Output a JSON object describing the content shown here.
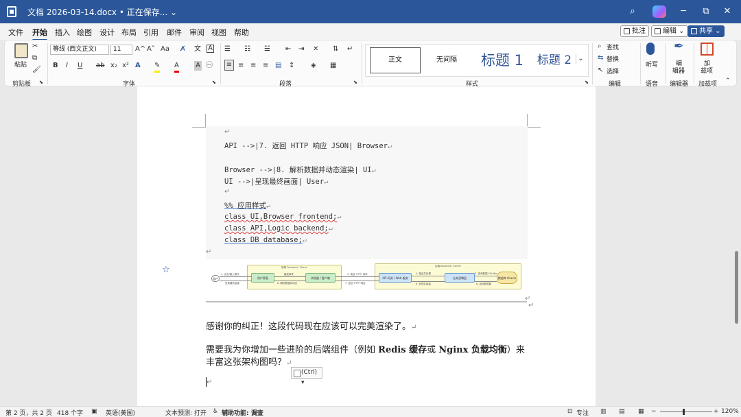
{
  "titlebar": {
    "title": "文档 2026-03-14.docx • 正在保存... ⌄",
    "search_icon": "search-icon",
    "minimize": "─",
    "restore": "⧉",
    "close": "✕"
  },
  "menu": {
    "tabs": [
      "文件",
      "开始",
      "插入",
      "绘图",
      "设计",
      "布局",
      "引用",
      "邮件",
      "审阅",
      "视图",
      "帮助"
    ],
    "active_index": 1,
    "comment_label": "批注",
    "edit_label": "编辑 ⌄",
    "share_label": "共享 ⌄"
  },
  "ribbon": {
    "clipboard": {
      "paste": "粘贴",
      "label": "剪贴板"
    },
    "font": {
      "font_name": "等线 (西文正文)",
      "font_size": "11",
      "grow": "A^",
      "shrink": "A˅",
      "change_case": "Aa",
      "bold": "B",
      "italic": "I",
      "underline": "U",
      "strike": "ab",
      "subscript": "x₂",
      "superscript": "x²",
      "label": "字体"
    },
    "paragraph": {
      "label": "段落"
    },
    "styles": {
      "items": [
        "正文",
        "无间隔",
        "标题 1",
        "标题 2"
      ],
      "label": "样式"
    },
    "editing": {
      "find": "查找",
      "replace": "替换",
      "select": "选择",
      "label": "编辑"
    },
    "voice": {
      "dictate": "听写",
      "label": "语音"
    },
    "editor": {
      "name": "编\n辑\n器",
      "name_line1": "编",
      "name_line2": "辑器",
      "label": "编辑器"
    },
    "addins": {
      "name_line1": "加",
      "name_line2": "载项",
      "label": "加载项"
    }
  },
  "document": {
    "code_lines": [
      {
        "pre": "API -->|7. 返回 HTTP 响应 JSON| Browser",
        "mark": true
      },
      {
        "pre": "Browser -->|8. 解析数据并动态渲染| UI",
        "mark": true
      },
      {
        "pre": "UI -->|呈现最终画面| User",
        "mark": true
      },
      {
        "pre": "%% 应用样式",
        "mark": true
      },
      {
        "pre": "class UI,Browser frontend;",
        "mark": true
      },
      {
        "pre": "class API,Logic backend;",
        "mark": true
      },
      {
        "pre": "class DB database;",
        "mark": true
      }
    ],
    "diagram": {
      "frontend_title": "前端 Frontend / Client",
      "backend_title": "后端 Backend / Server",
      "user": "用户",
      "ui": "用户界面",
      "browser": "浏览器 / 客户端",
      "api": "API 网关 / Web 服务",
      "logic": "业务逻辑层",
      "db": "数据库 Oracle",
      "e1": "1. 点击/输入操作",
      "e2": "触发事件",
      "e3": "3. 发起 HTTP 请求",
      "e4": "4. 路由并处理",
      "e5": "5. 查询数据 SQL/No",
      "e6": "6. 返回数据集",
      "e7": "6. 处理并组装",
      "e8": "7. 返回 HTTP 响应",
      "e9": "8. 解析数据并动态",
      "e10": "呈现最终画面"
    },
    "para1": "感谢你的纠正！这段代码现在应该可以完美渲染了。",
    "para2_a": "需要我为你增加一些进阶的后端组件（例如 ",
    "para2_b1": "Redis 缓存",
    "para2_c": "或 ",
    "para2_b2": "Nginx 负载均衡",
    "para2_d": "）来",
    "para3": "丰富这张架构图吗？",
    "paste_tag": "(Ctrl) ▾"
  },
  "status": {
    "page": "第 2 页，共 2 页",
    "words": "418 个字",
    "lang": "英语(美国)",
    "prediction": "文本预测: 打开",
    "accessibility": "辅助功能: 调查",
    "focus": "专注",
    "zoom": "120%"
  }
}
